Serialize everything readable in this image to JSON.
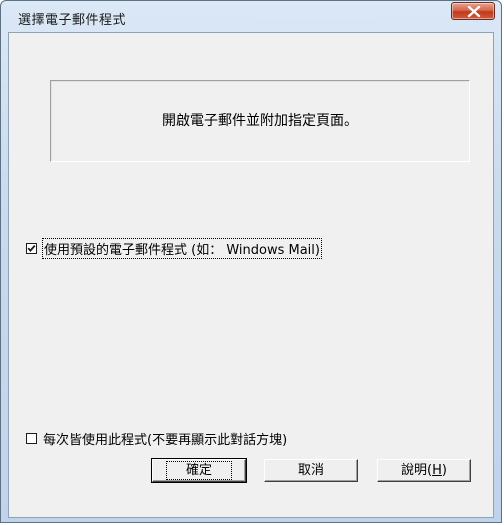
{
  "dialog": {
    "title": "選擇電子郵件程式",
    "info_text": "開啟電子郵件並附加指定頁面。",
    "use_default_option": {
      "label": "使用預設的電子郵件程式 (如： Windows Mail)",
      "checked": true
    },
    "always_use_option": {
      "label": "每次皆使用此程式(不要再顯示此對話方塊)",
      "checked": false
    },
    "buttons": {
      "ok": "確定",
      "cancel": "取消",
      "help_prefix": "說明(",
      "help_mnemonic": "H",
      "help_suffix": ")"
    }
  },
  "icons": {
    "close": "close-icon",
    "check": "check-icon"
  },
  "colors": {
    "close_button": "#c2391a",
    "title_bar": "#c8dbef",
    "client_background": "#f0f0f0"
  }
}
